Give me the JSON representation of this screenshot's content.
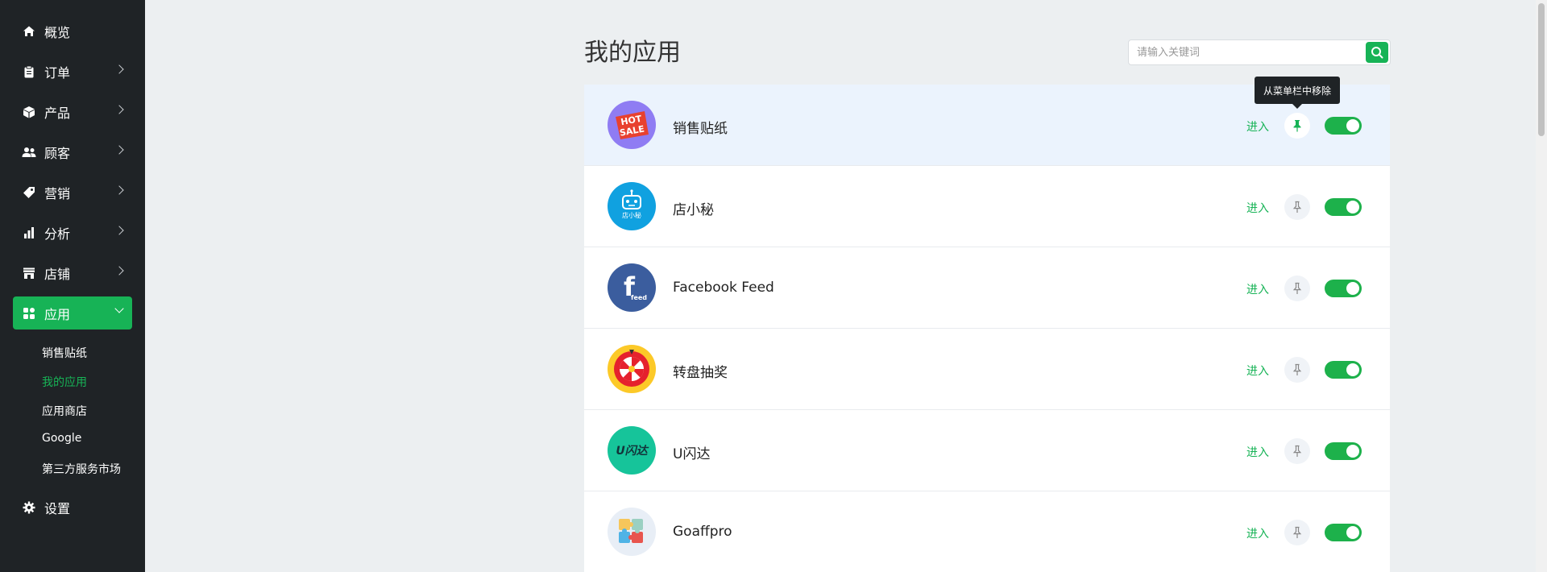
{
  "sidebar": {
    "items": [
      {
        "label": "概览",
        "icon": "home-icon"
      },
      {
        "label": "订单",
        "icon": "clipboard-icon"
      },
      {
        "label": "产品",
        "icon": "box-icon"
      },
      {
        "label": "顾客",
        "icon": "users-icon"
      },
      {
        "label": "营销",
        "icon": "tag-icon"
      },
      {
        "label": "分析",
        "icon": "bar-chart-icon"
      },
      {
        "label": "店铺",
        "icon": "store-icon"
      },
      {
        "label": "应用",
        "icon": "apps-icon"
      },
      {
        "label": "设置",
        "icon": "gear-icon"
      }
    ],
    "sub_items": [
      "销售贴纸",
      "我的应用",
      "应用商店",
      "Google",
      "第三方服务市场"
    ]
  },
  "main": {
    "title": "我的应用",
    "search": {
      "placeholder": "请输入关键词",
      "value": ""
    },
    "tooltip": "从菜单栏中移除",
    "enter_label": "进入",
    "apps": [
      {
        "name": "销售贴纸",
        "logo_text_1": "HOT",
        "logo_text_2": "SALE",
        "pinned": true,
        "enabled": true
      },
      {
        "name": "店小秘",
        "logo_text_1": "店小秘",
        "pinned": false,
        "enabled": true
      },
      {
        "name": "Facebook Feed",
        "logo_text_1": "f",
        "logo_text_2": "feed",
        "pinned": false,
        "enabled": true
      },
      {
        "name": "转盘抽奖",
        "pinned": false,
        "enabled": true
      },
      {
        "name": "U闪达",
        "logo_text_1": "U闪达",
        "pinned": false,
        "enabled": true
      },
      {
        "name": "Goaffpro",
        "pinned": false,
        "enabled": true
      }
    ]
  },
  "colors": {
    "accent": "#17b356",
    "sidebar_bg": "#1f2326",
    "page_bg": "#eceff1",
    "row_hover": "#ebf3fd"
  }
}
